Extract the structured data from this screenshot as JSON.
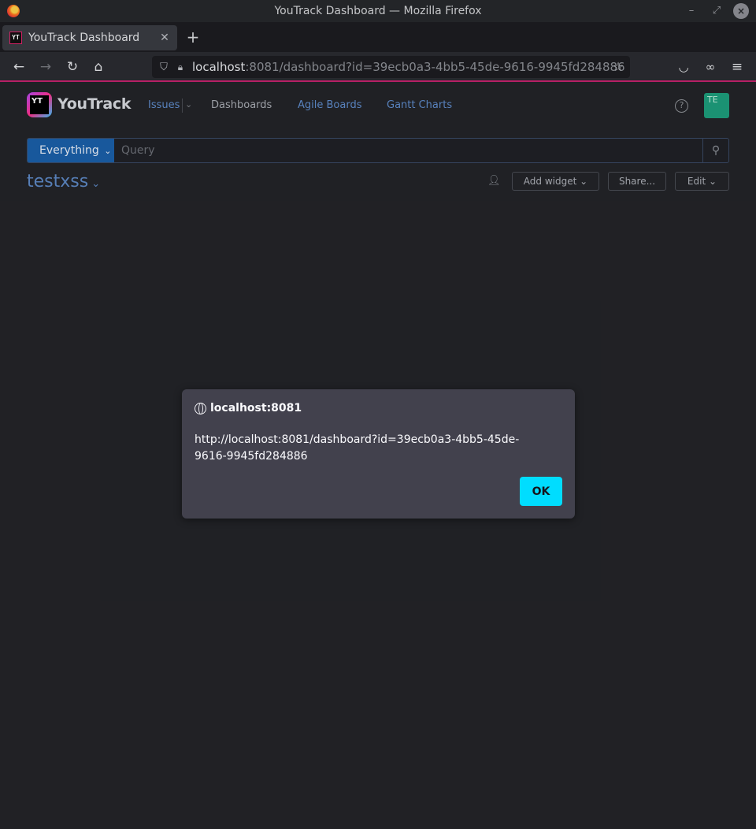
{
  "window": {
    "title": "YouTrack Dashboard — Mozilla Firefox"
  },
  "tabs": [
    {
      "label": "YouTrack Dashboard",
      "favicon_text": "YT"
    }
  ],
  "urlbar": {
    "host": "localhost",
    "rest": ":8081/dashboard?id=39ecb0a3-4bb5-45de-9616-9945fd284886"
  },
  "app": {
    "brand": "YouTrack",
    "logo_text": "YT",
    "nav": {
      "issues": "Issues",
      "dashboards": "Dashboards",
      "agile_boards": "Agile Boards",
      "gantt_charts": "Gantt Charts"
    },
    "avatar_initials": "TE",
    "search": {
      "context": "Everything",
      "placeholder": "Query"
    },
    "dashboard": {
      "title": "testxss",
      "add_widget": "Add widget",
      "share": "Share...",
      "edit": "Edit"
    }
  },
  "dialog": {
    "origin": "localhost:8081",
    "message": "http://localhost:8081/dashboard?id=39ecb0a3-4bb5-45de-9616-9945fd284886",
    "ok_label": "OK"
  },
  "colors": {
    "accent_bar": "#c5236d",
    "search_context": "#1a5fa8",
    "ok_button": "#00ddff",
    "avatar": "#1e9e7c"
  }
}
